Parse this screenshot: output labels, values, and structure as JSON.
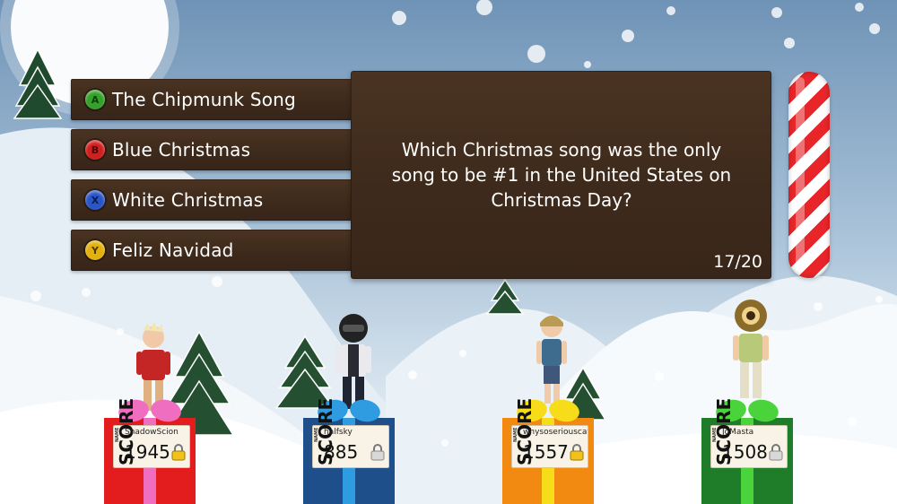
{
  "question": {
    "text": "Which Christmas song was the only song to be #1 in the United States on Christmas Day?",
    "counter": "17/20"
  },
  "answers": [
    {
      "label": "The Chipmunk Song",
      "button": "A",
      "color": "#35a02a"
    },
    {
      "label": "Blue Christmas",
      "button": "B",
      "color": "#d01f1f"
    },
    {
      "label": "White Christmas",
      "button": "X",
      "color": "#2a55c8"
    },
    {
      "label": "Feliz Navidad",
      "button": "Y",
      "color": "#e2b10e"
    }
  ],
  "card_labels": {
    "name": "NAME",
    "score": "SCORE"
  },
  "players": [
    {
      "gamertag": "ShadowScion",
      "score": "1945",
      "gift_color": "#e31d1d",
      "ribbon_color": "#ef6ec0"
    },
    {
      "gamertag": "halfsky",
      "score": "885",
      "gift_color": "#1f4f8a",
      "ribbon_color": "#2f9be0"
    },
    {
      "gamertag": "whysoseriouscat",
      "score": "1557",
      "gift_color": "#f28a12",
      "ribbon_color": "#f7dd19"
    },
    {
      "gamertag": "JoMasta",
      "score": "1508",
      "gift_color": "#1f7d2a",
      "ribbon_color": "#4bd33c"
    }
  ]
}
